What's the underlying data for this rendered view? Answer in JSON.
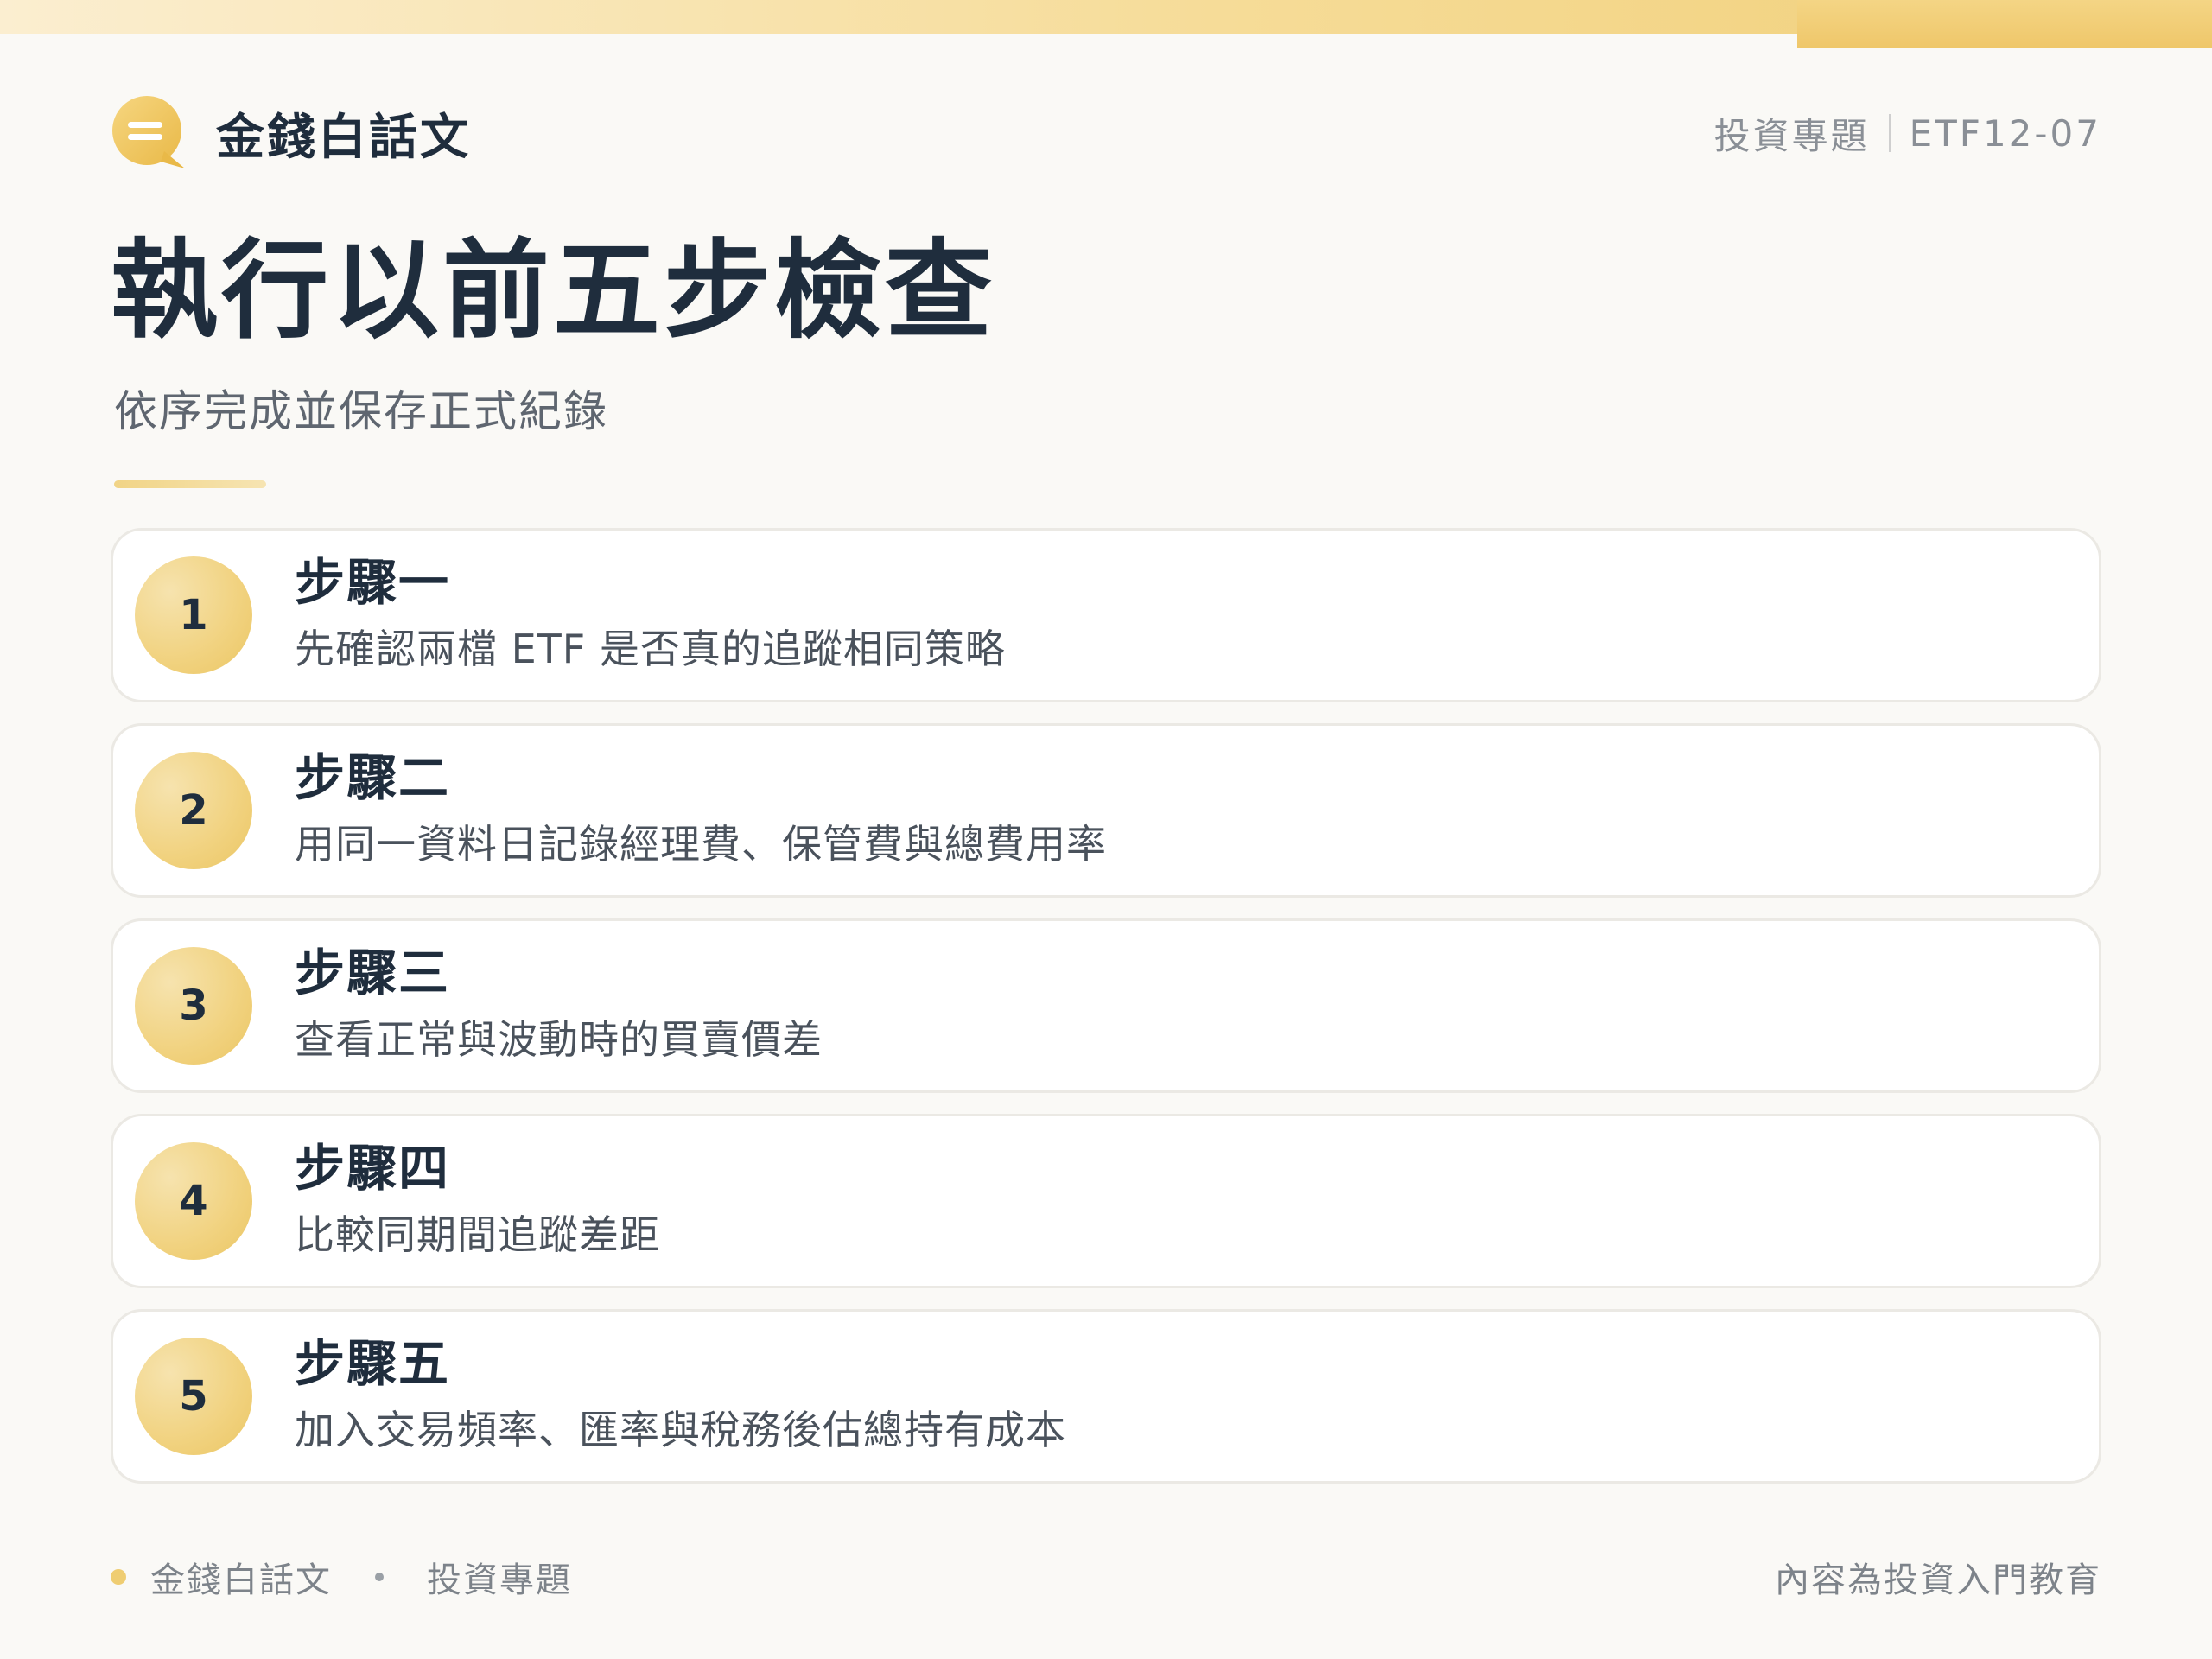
{
  "brand": {
    "name": "金錢白話文",
    "logo_icon": "chat-bubble-icon",
    "accent": "#efc76a"
  },
  "header": {
    "category": "投資專題",
    "code": "ETF12-07"
  },
  "page": {
    "title": "執行以前五步檢查",
    "subtitle": "依序完成並保存正式紀錄"
  },
  "steps": [
    {
      "number": "1",
      "title": "步驟一",
      "description": "先確認兩檔 ETF 是否真的追蹤相同策略"
    },
    {
      "number": "2",
      "title": "步驟二",
      "description": "用同一資料日記錄經理費、保管費與總費用率"
    },
    {
      "number": "3",
      "title": "步驟三",
      "description": "查看正常與波動時的買賣價差"
    },
    {
      "number": "4",
      "title": "步驟四",
      "description": "比較同期間追蹤差距"
    },
    {
      "number": "5",
      "title": "步驟五",
      "description": "加入交易頻率、匯率與稅務後估總持有成本"
    }
  ],
  "footer": {
    "brand": "金錢白話文",
    "category": "投資專題",
    "disclaimer": "內容為投資入門教育"
  }
}
